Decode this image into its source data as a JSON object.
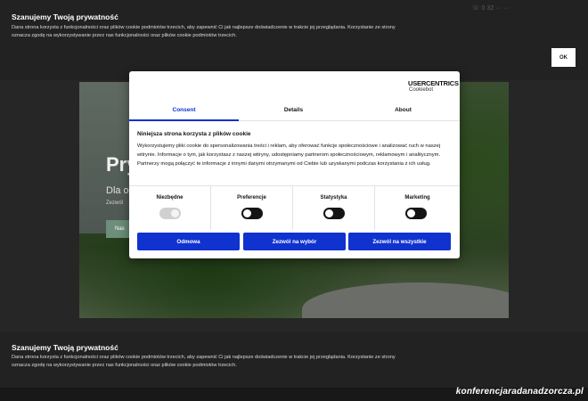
{
  "header": {
    "phone": "☏ 0 32 ··· ···",
    "privacy_title": "Szanujemy Twoją prywatność",
    "privacy_text": "Dana strona korzysta z funkcjonalności oraz plików cookie podmiotów trzecich, aby zapewnić Ci jak najlepsze doświadczenie w trakcie jej przeglądania. Korzystanie ze strony oznacza zgodę na wykorzystywanie przez nas funkcjonalności oraz plików cookie podmiotów trzecich.",
    "ok_label": "OK"
  },
  "hero": {
    "title": "Pry",
    "subtitle": "Dla o",
    "small": "Zezwól",
    "button_label": "Nas"
  },
  "dialog": {
    "logo_main": "USERCENTRICS",
    "logo_sub": "Cookiebot",
    "tabs": [
      {
        "label": "Consent"
      },
      {
        "label": "Details"
      },
      {
        "label": "About"
      }
    ],
    "section_title": "Niniejsza strona korzysta z plików cookie",
    "section_text": "Wykorzystujemy pliki cookie do spersonalizowania treści i reklam, aby oferować funkcje społecznościowe i analizować ruch w naszej witrynie. Informacje o tym, jak korzystasz z naszej witryny, udostępniamy partnerom społecznościowym, reklamowym i analitycznym. Partnerzy mogą połączyć te informacje z innymi danymi otrzymanymi od Ciebie lub uzyskanymi podczas korzystania z ich usług.",
    "toggles": [
      {
        "label": "Niezbędne"
      },
      {
        "label": "Preferencje"
      },
      {
        "label": "Statystyka"
      },
      {
        "label": "Marketing"
      }
    ],
    "buttons": {
      "deny": "Odmowa",
      "allow_selection": "Zezwól na wybór",
      "allow_all": "Zezwól na wszystkie"
    }
  },
  "bottom": {
    "privacy_title": "Szanujemy Twoją prywatność",
    "privacy_text": "Dana strona korzysta z funkcjonalności oraz plików cookie podmiotów trzecich, aby zapewnić Ci jak najlepsze doświadczenie w trakcie jej przeglądania. Korzystanie ze strony oznacza zgodę na wykorzystywanie przez nas funkcjonalności oraz plików cookie podmiotów trzecich."
  },
  "watermark": "konferencjaradanadzorcza.pl"
}
